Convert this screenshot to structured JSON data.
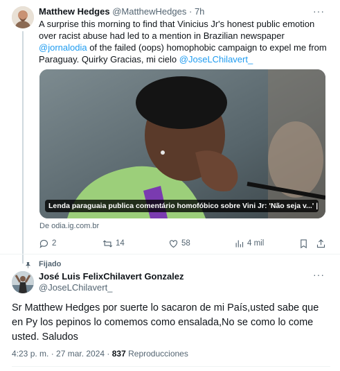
{
  "tweet1": {
    "author_name": "Matthew Hedges",
    "author_handle": "@MatthewHedges",
    "separator": "·",
    "time": "7h",
    "more": "···",
    "text_part1": "A surprise this morning to find that Vinicius Jr's honest public emotion over racist abuse had led to a mention in Brazilian newspaper ",
    "mention1": "@jornalodia",
    "text_part2": " of the failed (oops) homophobic campaign to expel me from Paraguay. Quirky Gracias, mi cielo ",
    "mention2": "@JoseLChilavert_",
    "card_caption": "Lenda paraguaia publica comentário homofóbico sobre Vini Jr: 'Não seja v...' | Es...",
    "card_source": "De odia.ig.com.br",
    "actions": {
      "replies": "2",
      "reposts": "14",
      "likes": "58",
      "views": "4 mil"
    }
  },
  "tweet2": {
    "pinned_label": "Fijado",
    "author_name": "José Luis FelixChilavert Gonzalez",
    "author_handle": "@JoseLChilavert_",
    "more": "···",
    "text": "Sr Matthew Hedges por suerte lo sacaron de mi País,usted sabe que en Py los pepinos lo comemos como ensalada,No se como lo come usted. Saludos",
    "timestamp": "4:23 p. m. · 27 mar. 2024 · ",
    "views_count": "837",
    "views_label": " Reproducciones"
  },
  "colors": {
    "text": "#0f1419",
    "muted": "#536471",
    "link": "#1d9bf0",
    "border": "#eff3f4"
  },
  "icons": [
    "reply-icon",
    "repost-icon",
    "like-icon",
    "views-icon",
    "bookmark-icon",
    "share-icon",
    "pin-icon",
    "more-icon"
  ]
}
